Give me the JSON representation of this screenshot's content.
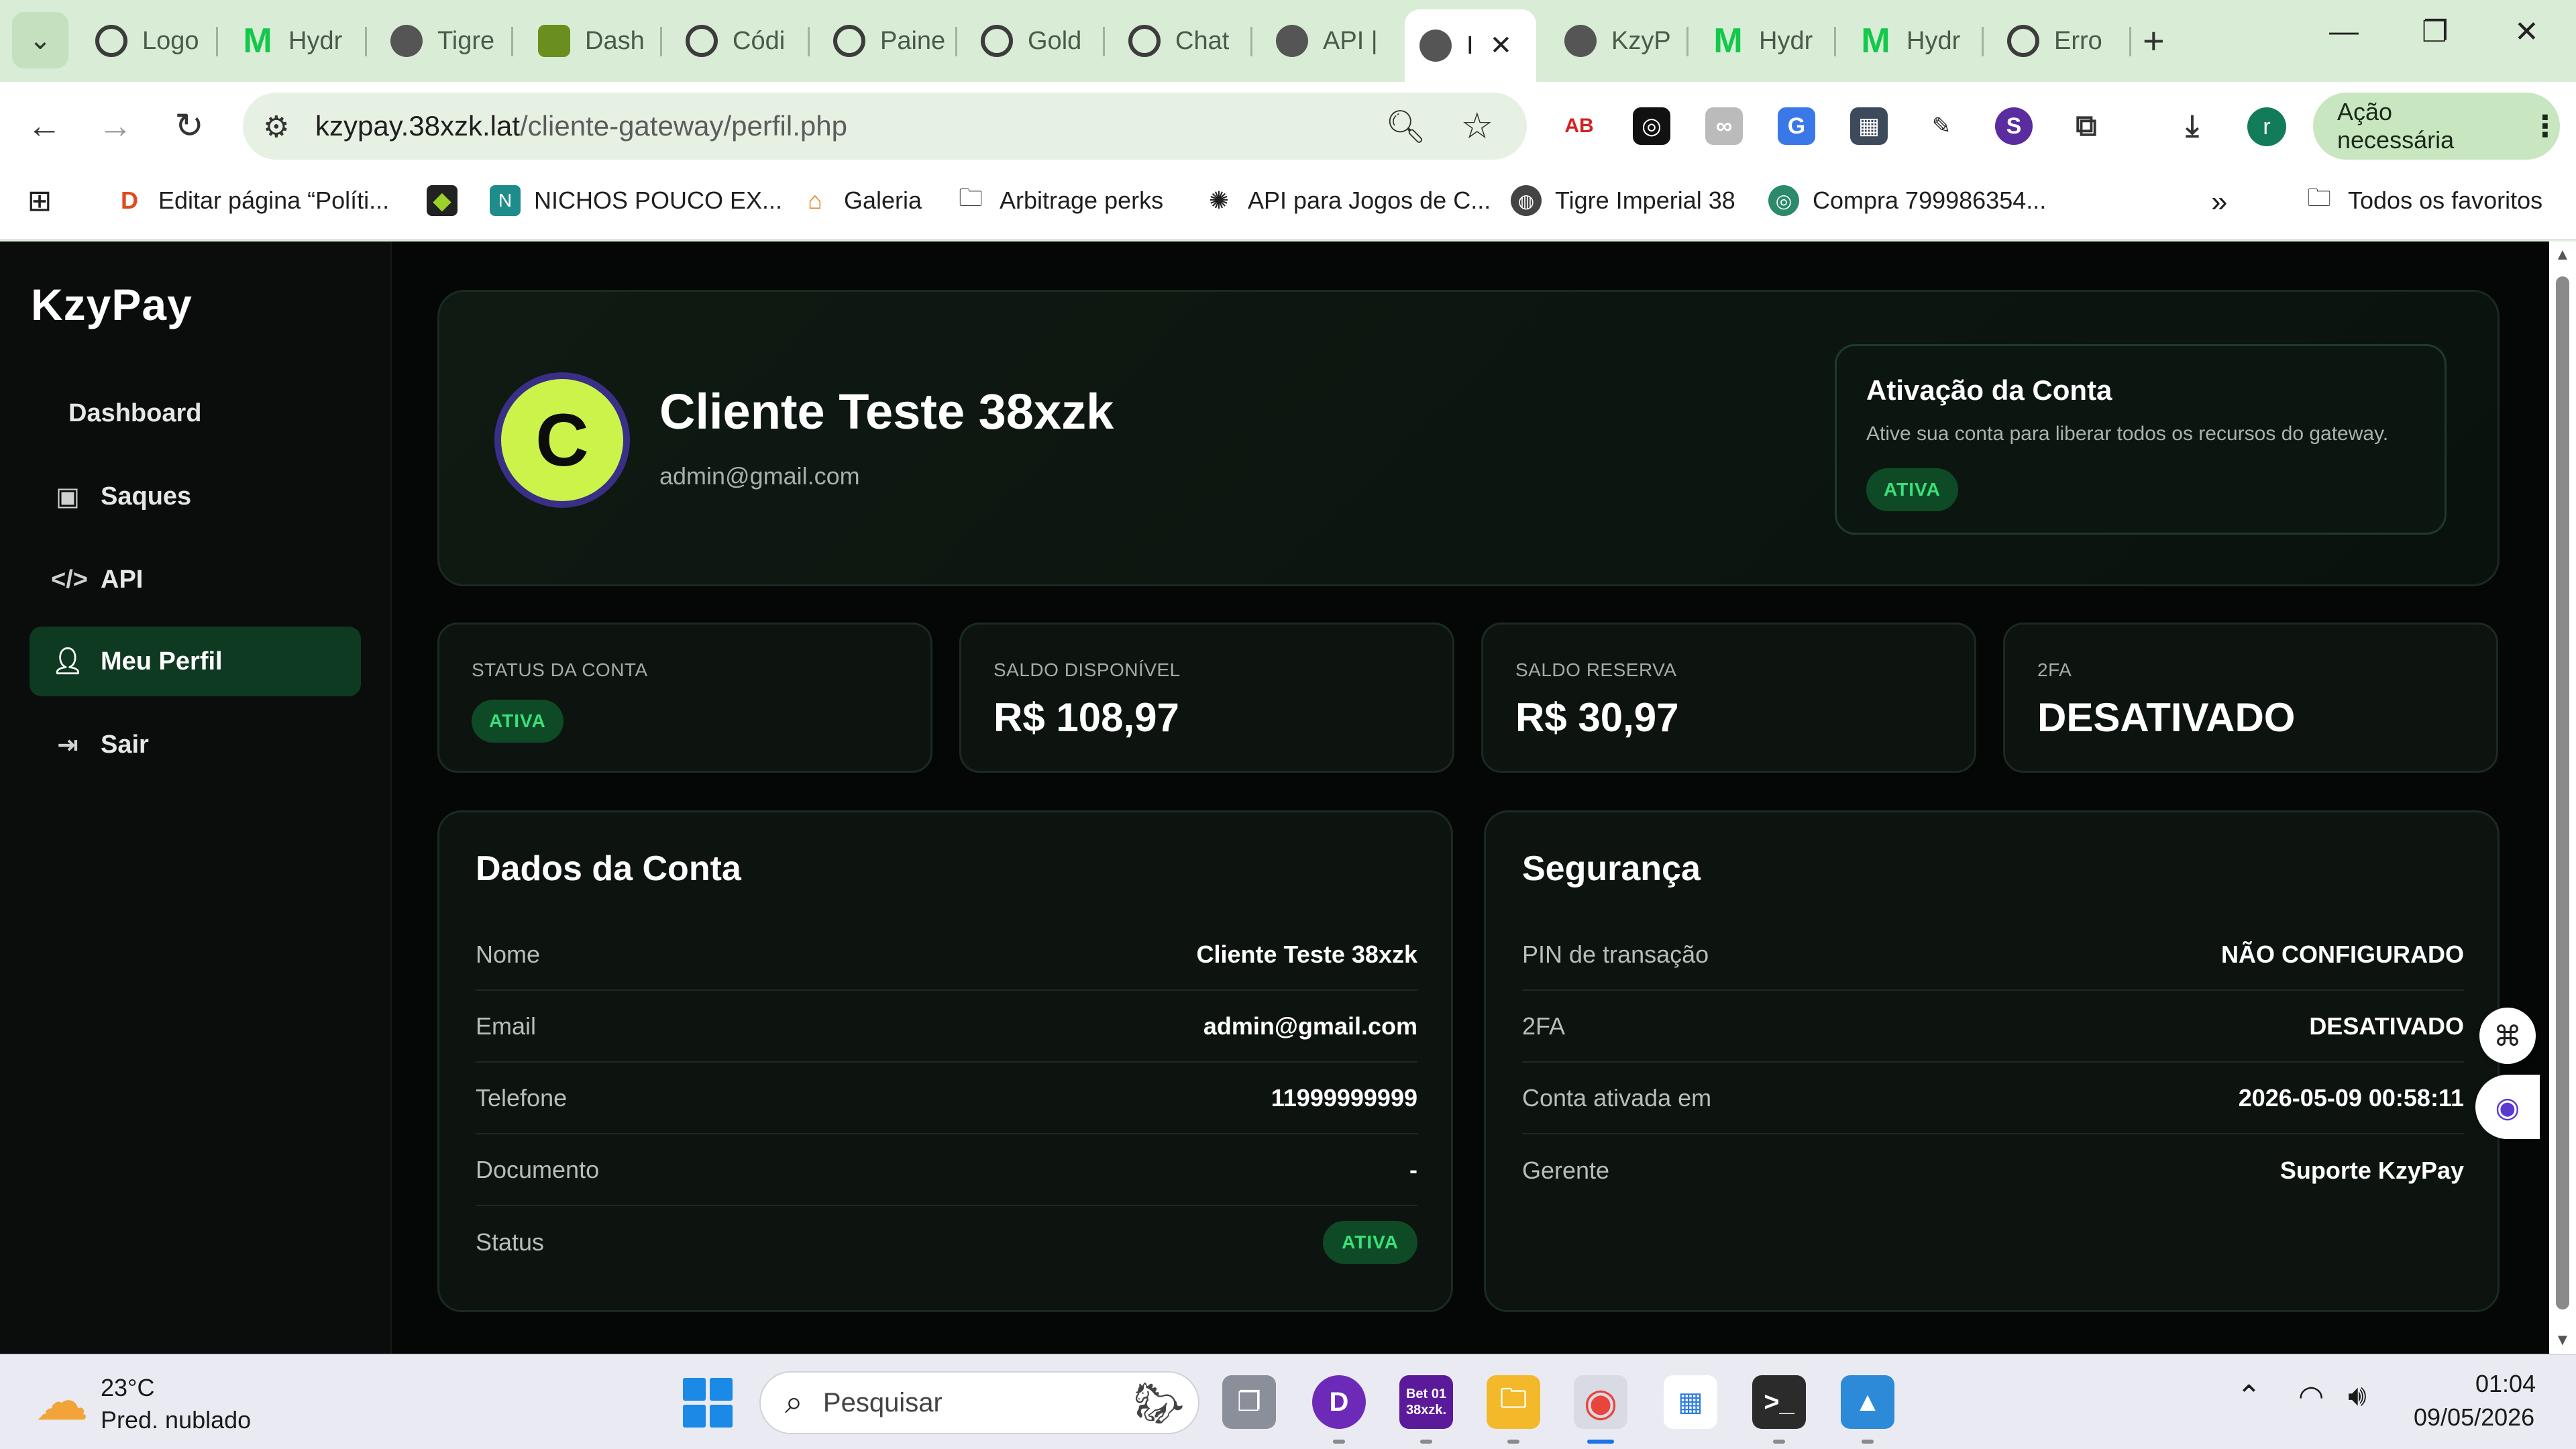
{
  "browser": {
    "tabs": [
      {
        "label": "Logo",
        "icon": "chatgpt-icon"
      },
      {
        "label": "Hydr",
        "icon": "hydra-icon"
      },
      {
        "label": "Tigre",
        "icon": "globe-icon"
      },
      {
        "label": "Dash",
        "icon": "dashboard-icon"
      },
      {
        "label": "Códi",
        "icon": "chatgpt-icon"
      },
      {
        "label": "Paine",
        "icon": "chatgpt-icon"
      },
      {
        "label": "Gold",
        "icon": "chatgpt-icon"
      },
      {
        "label": "Chat",
        "icon": "chatgpt-icon"
      },
      {
        "label": "API |",
        "icon": "globe-icon"
      },
      {
        "label": "I",
        "icon": "globe-icon",
        "active": true
      },
      {
        "label": "KzyP",
        "icon": "globe-icon"
      },
      {
        "label": "Hydr",
        "icon": "hydra-icon"
      },
      {
        "label": "Hydr",
        "icon": "hydra-icon"
      },
      {
        "label": "Erro",
        "icon": "chatgpt-icon"
      }
    ],
    "url_host": "kzypay.38xzk.lat",
    "url_path": "/cliente-gateway/perfil.php",
    "profile_initial": "r",
    "action_needed": "Ação necessária",
    "bookmarks": [
      {
        "label": "Editar página “Políti...",
        "icon": "ds-icon"
      },
      {
        "label": "",
        "icon": "game-icon"
      },
      {
        "label": "NICHOS POUCO EX...",
        "icon": "app-icon"
      },
      {
        "label": "Galeria",
        "icon": "home-icon"
      },
      {
        "label": "Arbitrage perks",
        "icon": "folder-icon"
      },
      {
        "label": "API para Jogos de C...",
        "icon": "chatgpt-icon"
      },
      {
        "label": "Tigre Imperial 38",
        "icon": "globe-icon"
      },
      {
        "label": "Compra 799986354...",
        "icon": "coin-icon"
      }
    ],
    "all_favorites": "Todos os favoritos"
  },
  "sidebar": {
    "brand": "KzyPay",
    "items": [
      {
        "label": "Dashboard",
        "icon": "",
        "active": false
      },
      {
        "label": "Saques",
        "icon": "money-icon",
        "active": false
      },
      {
        "label": "API",
        "icon": "code-icon",
        "active": false
      },
      {
        "label": "Meu Perfil",
        "icon": "user-icon",
        "active": true
      },
      {
        "label": "Sair",
        "icon": "logout-icon",
        "active": false
      }
    ]
  },
  "profile": {
    "avatar_initial": "C",
    "name": "Cliente Teste 38xzk",
    "email": "admin@gmail.com",
    "activation": {
      "title": "Ativação da Conta",
      "description": "Ative sua conta para liberar todos os recursos do gateway.",
      "badge": "ATIVA"
    }
  },
  "stats": [
    {
      "label": "STATUS DA CONTA",
      "value": "ATIVA",
      "is_badge": true
    },
    {
      "label": "SALDO DISPONÍVEL",
      "value": "R$ 108,97"
    },
    {
      "label": "SALDO RESERVA",
      "value": "R$ 30,97"
    },
    {
      "label": "2FA",
      "value": "DESATIVADO"
    }
  ],
  "account_data": {
    "title": "Dados da Conta",
    "rows": [
      {
        "key": "Nome",
        "value": "Cliente Teste 38xzk"
      },
      {
        "key": "Email",
        "value": "admin@gmail.com"
      },
      {
        "key": "Telefone",
        "value": "11999999999"
      },
      {
        "key": "Documento",
        "value": "-"
      },
      {
        "key": "Status",
        "value": "ATIVA"
      }
    ]
  },
  "security": {
    "title": "Segurança",
    "rows": [
      {
        "key": "PIN de transação",
        "value": "NÃO CONFIGURADO"
      },
      {
        "key": "2FA",
        "value": "DESATIVADO"
      },
      {
        "key": "Conta ativada em",
        "value": "2026-05-09 00:58:11"
      },
      {
        "key": "Gerente",
        "value": "Suporte KzyPay"
      }
    ]
  },
  "taskbar": {
    "weather_temp": "23°C",
    "weather_condition": "Pred. nublado",
    "search_placeholder": "Pesquisar",
    "app_bet_label": "Bet 01 38xzk.",
    "time": "01:04",
    "date": "09/05/2026"
  },
  "colors": {
    "accent_green": "#0f3a22",
    "badge_text": "#3ae07a",
    "avatar_bg": "#ccf34a",
    "avatar_ring": "#3a2f86",
    "page_bg": "#040705"
  }
}
